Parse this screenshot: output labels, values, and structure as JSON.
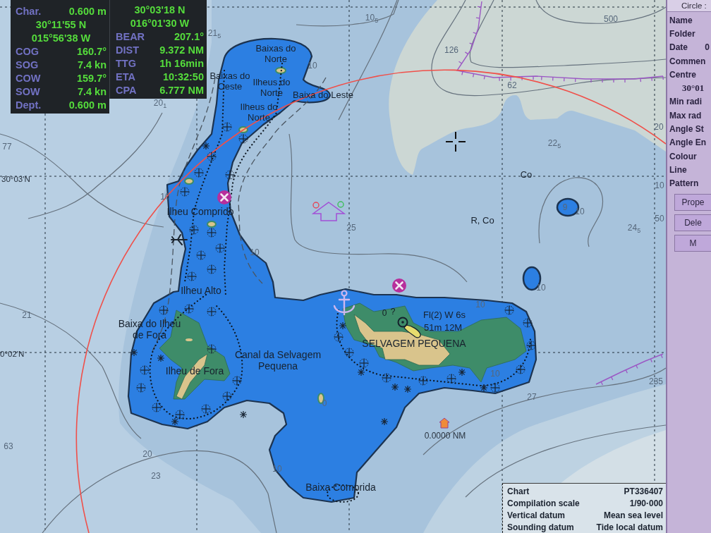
{
  "own_ship_panel": {
    "rows": [
      {
        "label": "Char.",
        "value": "0.600 m"
      },
      {
        "value": "30°11'55 N"
      },
      {
        "value": "015°56'38 W"
      },
      {
        "label": "COG",
        "value": "160.7°"
      },
      {
        "label": "SOG",
        "value": "7.4 kn"
      },
      {
        "label": "COW",
        "value": "159.7°"
      },
      {
        "label": "SOW",
        "value": "7.4 kn"
      },
      {
        "label": "Dept.",
        "value": "0.600 m"
      }
    ]
  },
  "cursor_panel": {
    "rows": [
      {
        "value": "30°03'18 N"
      },
      {
        "value": "016°01'30 W"
      },
      {
        "label": "BEAR",
        "value": "207.1°"
      },
      {
        "label": "DIST",
        "value": "9.372 NM"
      },
      {
        "label": "TTG",
        "value": "1h 16min"
      },
      {
        "label": "ETA",
        "value": "10:32:50"
      },
      {
        "label": "CPA",
        "value": "6.777 NM"
      }
    ]
  },
  "chart": {
    "latitude_labels": [
      "30°03'N",
      "0°02'N"
    ],
    "place_names": [
      "Baixas do Norte",
      "Baixas do Oeste",
      "Ilheus do Norte",
      "Baixa do Leste",
      "Ilheus do Norte",
      "Ilheu Comprido",
      "Ilheu Alto",
      "Baixa do Ilheu de Fora",
      "Ilheu de Fora",
      "Canal da Selvagem Pequena",
      "SELVAGEM PEQUENA",
      "Baixa Comprida"
    ],
    "seabed_labels": [
      "Co",
      "R, Co"
    ],
    "light_description": [
      "Fl(2) W 6s",
      "51m 12M"
    ],
    "query_mark": "?",
    "range_label": "0.0000 NM",
    "soundings": [
      "10$_{5}$",
      "21$_{5}$",
      "500",
      "126",
      "10",
      "62",
      "20$_{1}$",
      "20",
      "22$_{5}$",
      "77",
      "10",
      "10",
      "9",
      "10",
      "50",
      "24$_{5}$",
      "25",
      "10",
      "10",
      "10",
      "0",
      "21",
      "10",
      "235",
      "27",
      "0",
      "63",
      "20",
      "10",
      "23"
    ]
  },
  "chart_info": {
    "rows": [
      {
        "label": "Chart",
        "value": "PT336407"
      },
      {
        "label": "Compilation scale",
        "value": "1/90·000"
      },
      {
        "label": "Vertical datum",
        "value": "Mean sea level"
      },
      {
        "label": "Sounding datum",
        "value": "Tide local datum"
      }
    ]
  },
  "object_panel": {
    "title": "Circle :",
    "fields": [
      {
        "label": "Name"
      },
      {
        "label": "Folder"
      },
      {
        "label": "Date",
        "value": "0"
      },
      {
        "label": "Commen"
      },
      {
        "label": "Centre"
      },
      {
        "value": "30°01"
      },
      {
        "label": "Min radi"
      },
      {
        "label": "Max rad"
      },
      {
        "label": "Angle St"
      },
      {
        "label": "Angle En"
      },
      {
        "label": "Colour"
      },
      {
        "label": "Line"
      },
      {
        "label": "Pattern"
      }
    ],
    "buttons": [
      "Prope",
      "Dele",
      "M"
    ]
  }
}
